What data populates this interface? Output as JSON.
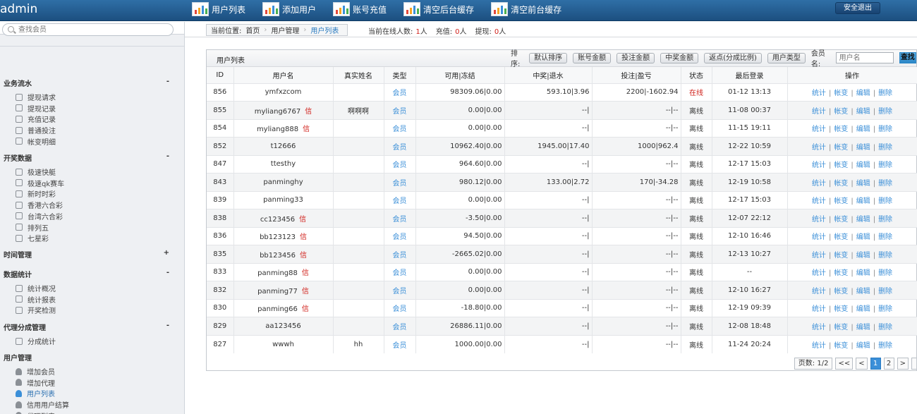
{
  "brand": "admin",
  "topnav": [
    "用户列表",
    "添加用户",
    "账号充值",
    "清空后台缓存",
    "清空前台缓存"
  ],
  "logout": "安全退出",
  "search": {
    "placeholder": "查找会员"
  },
  "sidebar": {
    "sections": [
      {
        "title": "业务流水",
        "toggle": "-",
        "items": [
          "提现请求",
          "提现记录",
          "充值记录",
          "普通投注",
          "帐变明细"
        ]
      },
      {
        "title": "开奖数据",
        "toggle": "-",
        "items": [
          "极速快艇",
          "极速qk赛车",
          "新时时彩",
          "香港六合彩",
          "台湾六合彩",
          "排列五",
          "七星彩"
        ]
      },
      {
        "title": "时间管理",
        "toggle": "+",
        "items": []
      },
      {
        "title": "数据统计",
        "toggle": "-",
        "items": [
          "统计概况",
          "统计报表",
          "开奖检测"
        ]
      },
      {
        "title": "代理分成管理",
        "toggle": "-",
        "items": [
          "分成统计"
        ]
      },
      {
        "title": "用户管理",
        "toggle": "",
        "items": [
          "增加会员",
          "增加代理",
          "用户列表",
          "信用用户结算",
          "代理列表"
        ]
      }
    ]
  },
  "breadcrumb": {
    "label": "当前位置:",
    "home": "首页",
    "l2": "用户管理",
    "current": "用户列表"
  },
  "stats": {
    "online_label": "当前在线人数:",
    "online": "1",
    "online_unit": "人",
    "recharge_label": "充值:",
    "recharge": "0",
    "recharge_unit": "人",
    "withdraw_label": "提现:",
    "withdraw": "0",
    "withdraw_unit": "人"
  },
  "panel": {
    "title": "用户列表",
    "sort_label": "排序:",
    "sort_buttons": [
      "默认排序",
      "账号金额",
      "投注金额",
      "中奖金额",
      "返点(分成比例)",
      "用户类型"
    ],
    "member_label": "会员名:",
    "member_placeholder": "用户名",
    "search_btn": "查找"
  },
  "table": {
    "headers": [
      "ID",
      "用户名",
      "真实姓名",
      "类型",
      "可用|冻结",
      "中奖|退水",
      "投注|盈亏",
      "状态",
      "最后登录",
      "操作"
    ],
    "xin": "信",
    "ops": [
      "统计",
      "帐变",
      "编辑",
      "删除"
    ],
    "rows": [
      {
        "id": "856",
        "user": "ymfxzcom",
        "xin": false,
        "real": "",
        "type": "会员",
        "bal": "98309.06|0.00",
        "win": "593.10|3.96",
        "bet": "2200|-1602.94",
        "status": "在线",
        "online": true,
        "last": "01-12 13:13"
      },
      {
        "id": "855",
        "user": "myliang6767",
        "xin": true,
        "real": "啊啊啊",
        "type": "会员",
        "bal": "0.00|0.00",
        "win": "--|",
        "bet": "--|--",
        "status": "离线",
        "online": false,
        "last": "11-08 00:37"
      },
      {
        "id": "854",
        "user": "myliang888",
        "xin": true,
        "real": "",
        "type": "会员",
        "bal": "0.00|0.00",
        "win": "--|",
        "bet": "--|--",
        "status": "离线",
        "online": false,
        "last": "11-15 19:11"
      },
      {
        "id": "852",
        "user": "t12666",
        "xin": false,
        "real": "",
        "type": "会员",
        "bal": "10962.40|0.00",
        "win": "1945.00|17.40",
        "bet": "1000|962.4",
        "status": "离线",
        "online": false,
        "last": "12-22 10:59"
      },
      {
        "id": "847",
        "user": "ttesthy",
        "xin": false,
        "real": "",
        "type": "会员",
        "bal": "964.60|0.00",
        "win": "--|",
        "bet": "--|--",
        "status": "离线",
        "online": false,
        "last": "12-17 15:03"
      },
      {
        "id": "843",
        "user": "panminghy",
        "xin": false,
        "real": "",
        "type": "会员",
        "bal": "980.12|0.00",
        "win": "133.00|2.72",
        "bet": "170|-34.28",
        "status": "离线",
        "online": false,
        "last": "12-19 10:58"
      },
      {
        "id": "839",
        "user": "panming33",
        "xin": false,
        "real": "",
        "type": "会员",
        "bal": "0.00|0.00",
        "win": "--|",
        "bet": "--|--",
        "status": "离线",
        "online": false,
        "last": "12-17 15:03"
      },
      {
        "id": "838",
        "user": "cc123456",
        "xin": true,
        "real": "",
        "type": "会员",
        "bal": "-3.50|0.00",
        "win": "--|",
        "bet": "--|--",
        "status": "离线",
        "online": false,
        "last": "12-07 22:12"
      },
      {
        "id": "836",
        "user": "bb123123",
        "xin": true,
        "real": "",
        "type": "会员",
        "bal": "94.50|0.00",
        "win": "--|",
        "bet": "--|--",
        "status": "离线",
        "online": false,
        "last": "12-10 16:46"
      },
      {
        "id": "835",
        "user": "bb123456",
        "xin": true,
        "real": "",
        "type": "会员",
        "bal": "-2665.02|0.00",
        "win": "--|",
        "bet": "--|--",
        "status": "离线",
        "online": false,
        "last": "12-13 10:27"
      },
      {
        "id": "833",
        "user": "panming88",
        "xin": true,
        "real": "",
        "type": "会员",
        "bal": "0.00|0.00",
        "win": "--|",
        "bet": "--|--",
        "status": "离线",
        "online": false,
        "last": "--"
      },
      {
        "id": "832",
        "user": "panming77",
        "xin": true,
        "real": "",
        "type": "会员",
        "bal": "0.00|0.00",
        "win": "--|",
        "bet": "--|--",
        "status": "离线",
        "online": false,
        "last": "12-10 16:27"
      },
      {
        "id": "830",
        "user": "panming66",
        "xin": true,
        "real": "",
        "type": "会员",
        "bal": "-18.80|0.00",
        "win": "--|",
        "bet": "--|--",
        "status": "离线",
        "online": false,
        "last": "12-19 09:39"
      },
      {
        "id": "829",
        "user": "aa123456",
        "xin": false,
        "real": "",
        "type": "会员",
        "bal": "26886.11|0.00",
        "win": "--|",
        "bet": "--|--",
        "status": "离线",
        "online": false,
        "last": "12-08 18:48"
      },
      {
        "id": "827",
        "user": "wwwh",
        "xin": false,
        "real": "hh",
        "type": "会员",
        "bal": "1000.00|0.00",
        "win": "--|",
        "bet": "--|--",
        "status": "离线",
        "online": false,
        "last": "11-24 20:24"
      }
    ]
  },
  "pager": {
    "info": "页数: 1/2",
    "first": "<<",
    "prev": "<",
    "pages": [
      "1",
      "2"
    ],
    "next": ">"
  },
  "colors": {
    "accent": "#3b8fd8",
    "red": "#d0211b",
    "topbar": "#1c4f80"
  }
}
